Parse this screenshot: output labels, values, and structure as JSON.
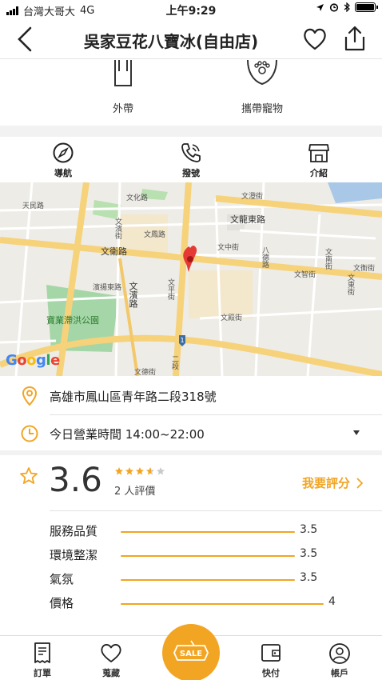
{
  "status_bar": {
    "carrier": "台灣大哥大",
    "network": "4G",
    "time": "上午9:29"
  },
  "header": {
    "title": "吳家豆花八寶冰(自由店)"
  },
  "services": [
    {
      "label": "外帶",
      "icon": "takeout-bag-icon"
    },
    {
      "label": "攜帶寵物",
      "icon": "pet-paw-icon"
    }
  ],
  "actions": [
    {
      "label": "導航",
      "icon": "compass-icon"
    },
    {
      "label": "撥號",
      "icon": "phone-icon"
    },
    {
      "label": "介紹",
      "icon": "storefront-icon"
    }
  ],
  "map": {
    "attribution": "Google",
    "route_number": "1",
    "labels": [
      "天民路",
      "文濱街",
      "文化路",
      "文鳳路",
      "文澄街",
      "文龍東路",
      "文衛路",
      "文中街",
      "八德路",
      "文智街",
      "文南街",
      "文東街",
      "文衡街",
      "濱揚東路",
      "文濱路",
      "文平街",
      "寶業滯洪公園",
      "文殿街",
      "二段",
      "文德街"
    ]
  },
  "info": {
    "address": "高雄市鳳山區青年路二段318號",
    "hours_label": "今日營業時間 14:00~22:00"
  },
  "rating": {
    "score": "3.6",
    "stars_value": 3.6,
    "count_label": "2 人評價",
    "rate_link": "我要評分",
    "criteria": [
      {
        "name": "服務品質",
        "value": "3.5",
        "fraction": 0.875
      },
      {
        "name": "環境整潔",
        "value": "3.5",
        "fraction": 0.875
      },
      {
        "name": "氣氛",
        "value": "3.5",
        "fraction": 0.875
      },
      {
        "name": "價格",
        "value": "4",
        "fraction": 1.0
      }
    ]
  },
  "tabs": [
    {
      "label": "訂單",
      "icon": "receipt-icon"
    },
    {
      "label": "蒐藏",
      "icon": "heart-icon"
    },
    {
      "label": "SALE",
      "icon": "sale-tag-icon"
    },
    {
      "label": "快付",
      "icon": "wallet-icon"
    },
    {
      "label": "帳戶",
      "icon": "account-icon"
    }
  ],
  "colors": {
    "accent": "#f2a523",
    "map_road_major": "#f6d27a",
    "map_park": "#a5d6a7",
    "pin": "#e53935"
  }
}
